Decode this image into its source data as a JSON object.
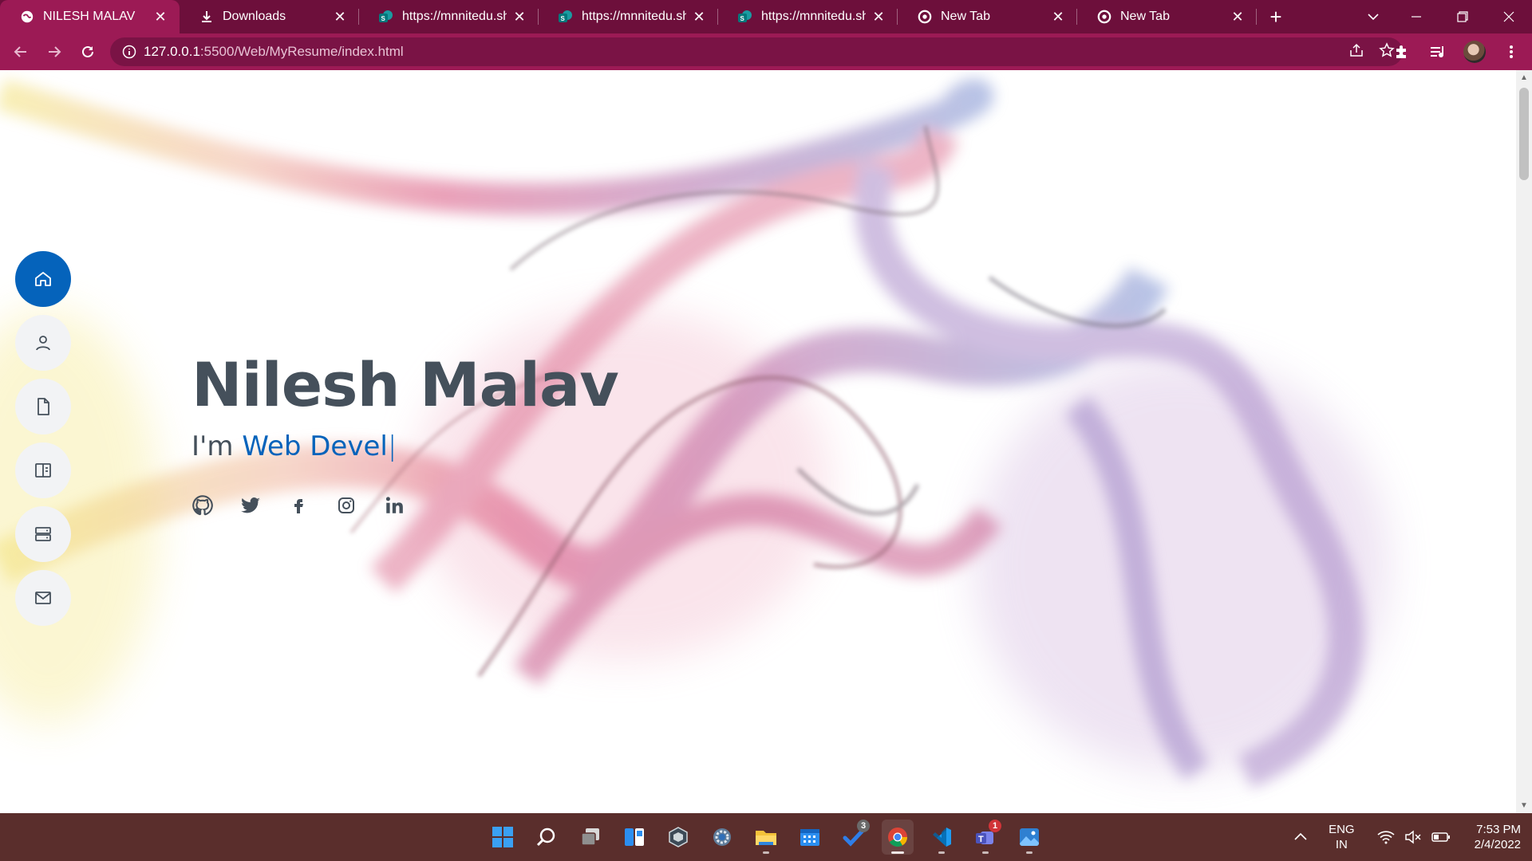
{
  "browser": {
    "tabs": [
      {
        "title": "NILESH MALAV",
        "icon": "globe-icon",
        "active": true
      },
      {
        "title": "Downloads",
        "icon": "download-icon",
        "active": false
      },
      {
        "title": "https://mnnitedu.shar",
        "icon": "sharepoint-icon",
        "active": false
      },
      {
        "title": "https://mnnitedu.shar",
        "icon": "sharepoint-icon",
        "active": false
      },
      {
        "title": "https://mnnitedu.shar",
        "icon": "sharepoint-icon",
        "active": false
      },
      {
        "title": "New Tab",
        "icon": "chrome-icon",
        "active": false
      },
      {
        "title": "New Tab",
        "icon": "chrome-icon",
        "active": false
      }
    ],
    "url_host": "127.0.0.1",
    "url_path": ":5500/Web/MyResume/index.html",
    "accent": "#9c1a55",
    "tabstrip_color": "#6d0f3b"
  },
  "page": {
    "name": "Nilesh Malav",
    "intro_prefix": "I'm ",
    "typed_text": "Web Devel",
    "cursor": "|",
    "accent_color": "#0563bb",
    "text_color": "#45505b",
    "nav_items": [
      {
        "name": "home",
        "icon": "home-icon",
        "active": true
      },
      {
        "name": "about",
        "icon": "person-icon",
        "active": false
      },
      {
        "name": "resume",
        "icon": "file-icon",
        "active": false
      },
      {
        "name": "portfolio",
        "icon": "book-icon",
        "active": false
      },
      {
        "name": "services",
        "icon": "server-icon",
        "active": false
      },
      {
        "name": "contact",
        "icon": "envelope-icon",
        "active": false
      }
    ],
    "socials": [
      "github-icon",
      "twitter-icon",
      "facebook-icon",
      "instagram-icon",
      "linkedin-icon"
    ]
  },
  "taskbar": {
    "apps": [
      "windows-start-icon",
      "search-icon",
      "task-view-icon",
      "widgets-icon",
      "app-icon",
      "settings-icon",
      "file-explorer-icon",
      "calendar-icon",
      "todo-icon",
      "chrome-icon",
      "vscode-icon",
      "teams-icon",
      "photos-icon"
    ],
    "todo_badge": "3",
    "teams_badge": "1",
    "lang_line1": "ENG",
    "lang_line2": "IN",
    "time": "7:53 PM",
    "date": "2/4/2022"
  }
}
